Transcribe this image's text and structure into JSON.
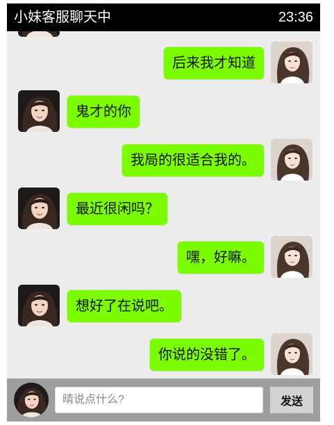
{
  "header": {
    "title": "小妹客服聊天中",
    "time": "23:36"
  },
  "messages": [
    {
      "side": "right",
      "text": "后来我才知道",
      "avatar": "user-avatar"
    },
    {
      "side": "left",
      "text": "鬼才的你",
      "avatar": "agent-avatar"
    },
    {
      "side": "right",
      "text": "我局的很适合我的。",
      "avatar": "user-avatar"
    },
    {
      "side": "left",
      "text": "最近很闲吗？",
      "avatar": "agent-avatar"
    },
    {
      "side": "right",
      "text": "嘿，好嘛。",
      "avatar": "user-avatar"
    },
    {
      "side": "left",
      "text": "想好了在说吧。",
      "avatar": "agent-avatar"
    },
    {
      "side": "right",
      "text": "你说的没错了。",
      "avatar": "user-avatar"
    }
  ],
  "input": {
    "placeholder": "晴说点什么?",
    "value": ""
  },
  "send_label": "发送",
  "colors": {
    "bubble": "#7cfc00",
    "header_bg": "#000000",
    "chat_bg": "#ececec",
    "bottom_bar": "#9e9e9e",
    "send_button": "#d3d3d3"
  }
}
